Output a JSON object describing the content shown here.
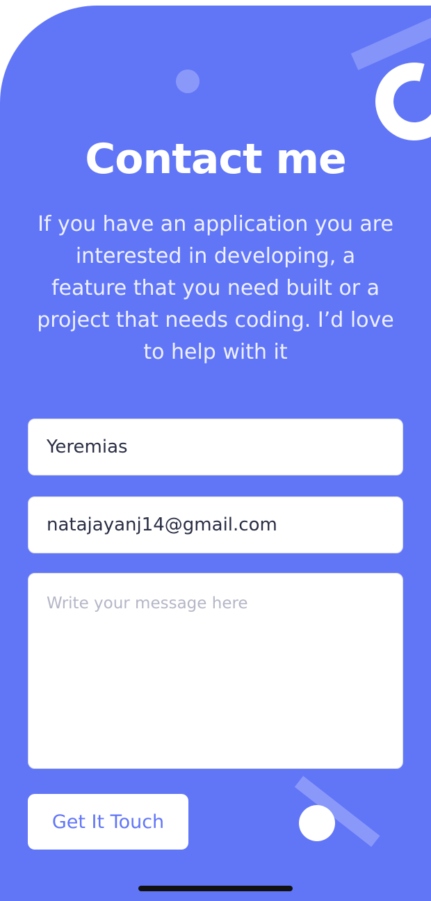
{
  "page": {
    "title": "Contact me",
    "description": "If you have an application you are interested in developing, a feature that you need built or a project that needs coding. I’d love to help with it"
  },
  "form": {
    "name_value": "Yeremias",
    "email_value": "natajayanj14@gmail.com",
    "message_placeholder": "Write your message here",
    "submit_label": "Get It Touch"
  },
  "colors": {
    "accent": "#6176f7",
    "card": "#ffffff"
  }
}
